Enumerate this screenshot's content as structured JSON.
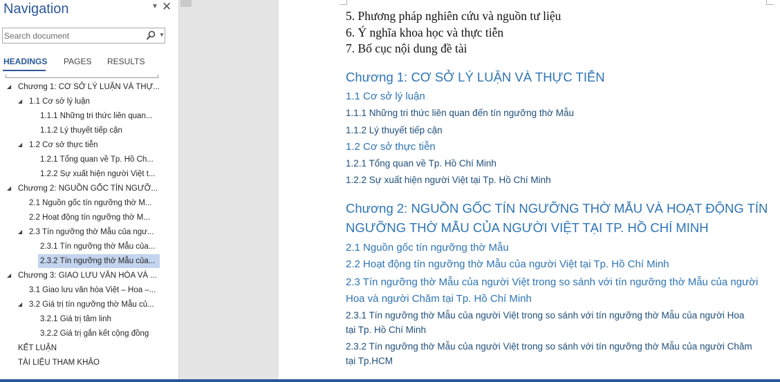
{
  "navigation": {
    "title": "Navigation",
    "search": {
      "placeholder": "Search document"
    },
    "tabs": [
      {
        "label": "HEADINGS",
        "active": true
      },
      {
        "label": "PAGES",
        "active": false
      },
      {
        "label": "RESULTS",
        "active": false
      }
    ],
    "items": [
      {
        "label": "Chương 1: CƠ SỞ LÝ LUẬN VÀ THỰ...",
        "level": 1,
        "expand": "expanded",
        "selected": false
      },
      {
        "label": "1.1 Cơ sở lý luận",
        "level": 2,
        "expand": "expanded",
        "selected": false
      },
      {
        "label": "1.1.1 Những tri thức liên quan...",
        "level": 3,
        "expand": "none",
        "selected": false
      },
      {
        "label": "1.1.2 Lý thuyết tiếp cận",
        "level": 3,
        "expand": "none",
        "selected": false
      },
      {
        "label": "1.2 Cơ sở thực tiễn",
        "level": 2,
        "expand": "expanded",
        "selected": false
      },
      {
        "label": "1.2.1 Tổng quan về Tp. Hồ Ch...",
        "level": 3,
        "expand": "none",
        "selected": false
      },
      {
        "label": "1.2.2 Sự xuất hiện người Việt t...",
        "level": 3,
        "expand": "none",
        "selected": false
      },
      {
        "label": "Chương 2: NGUỒN GỐC TÍN NGƯỠ...",
        "level": 1,
        "expand": "expanded",
        "selected": false
      },
      {
        "label": "2.1 Nguồn gốc tín ngưỡng thờ M...",
        "level": 2,
        "expand": "none",
        "selected": false
      },
      {
        "label": "2.2 Hoạt động tín ngưỡng thờ M...",
        "level": 2,
        "expand": "none",
        "selected": false
      },
      {
        "label": "2.3 Tín ngưỡng thờ Mẫu của ngư...",
        "level": 2,
        "expand": "expanded",
        "selected": false
      },
      {
        "label": "2.3.1 Tín ngưỡng thờ Mẫu của...",
        "level": 3,
        "expand": "none",
        "selected": false
      },
      {
        "label": "2.3.2 Tín ngưỡng thờ Mẫu của...",
        "level": 3,
        "expand": "none",
        "selected": true
      },
      {
        "label": "Chương 3: GIAO LƯU VĂN HÓA VÀ ...",
        "level": 1,
        "expand": "expanded",
        "selected": false
      },
      {
        "label": "3.1 Giao lưu văn hóa Việt – Hoa –...",
        "level": 2,
        "expand": "none",
        "selected": false
      },
      {
        "label": "3.2 Giá trị tín ngưỡng thờ Mẫu củ...",
        "level": 2,
        "expand": "expanded",
        "selected": false
      },
      {
        "label": "3.2.1 Giá trị tâm linh",
        "level": 3,
        "expand": "none",
        "selected": false
      },
      {
        "label": "3.2.2 Giá trị gắn kết cộng đồng",
        "level": 3,
        "expand": "none",
        "selected": false
      },
      {
        "label": "KẾT LUẬN",
        "level": 1,
        "expand": "none",
        "selected": false
      },
      {
        "label": "TÀI LIỆU THAM KHẢO",
        "level": 1,
        "expand": "none",
        "selected": false
      }
    ]
  },
  "document": {
    "lines": [
      {
        "style": "body",
        "text": "5. Phương pháp nghiên cứu và nguồn tư liệu"
      },
      {
        "style": "body",
        "text": "6. Ý nghĩa khoa học và thực tiễn"
      },
      {
        "style": "body",
        "text": "7. Bố cục nội dung đề tài"
      },
      {
        "style": "h1",
        "text": "Chương 1: CƠ SỞ LÝ LUẬN VÀ THỰC TIỄN"
      },
      {
        "style": "h2",
        "text": "1.1 Cơ sở lý luận"
      },
      {
        "style": "h3",
        "text": "1.1.1 Những tri thức liên quan đến tín ngưỡng thờ Mẫu"
      },
      {
        "style": "h3",
        "text": "1.1.2 Lý thuyết tiếp cận"
      },
      {
        "style": "h2",
        "text": "1.2 Cơ sở thực tiễn"
      },
      {
        "style": "h3",
        "text": "1.2.1 Tổng quan về Tp. Hồ Chí Minh"
      },
      {
        "style": "h3",
        "text": "1.2.2 Sự xuất hiện người Việt tại Tp. Hồ Chí Minh"
      },
      {
        "style": "h1",
        "text": "Chương 2: NGUỒN GỐC TÍN NGƯỠNG THỜ MẪU VÀ HOẠT ĐỘNG TÍN"
      },
      {
        "style": "h1",
        "text": "NGƯỠNG THỜ MẪU CỦA NGƯỜI VIỆT TẠI TP. HỒ CHÍ MINH"
      },
      {
        "style": "h2",
        "text": "2.1 Nguồn gốc tín ngưỡng thờ Mẫu"
      },
      {
        "style": "h2",
        "text": "2.2 Hoạt động tín ngưỡng thờ Mẫu của người Việt tại Tp. Hồ Chí Minh"
      },
      {
        "style": "h2",
        "text": "2.3 Tín ngưỡng thờ Mẫu của người Việt trong so sánh với tín ngưỡng thờ Mẫu của người"
      },
      {
        "style": "h2",
        "text": "Hoa và người Chăm tại Tp. Hồ Chí Minh"
      },
      {
        "style": "h3",
        "text": "2.3.1 Tín ngưỡng thờ Mẫu của người Việt trong so sánh với tín ngưỡng thờ Mẫu của người Hoa"
      },
      {
        "style": "h3",
        "text": "tại Tp. Hồ Chí Minh"
      },
      {
        "style": "h3",
        "text": "2.3.2 Tín ngưỡng thờ Mẫu của người Việt trong so sánh với tín ngưỡng thờ Mẫu của người Chăm"
      },
      {
        "style": "h3",
        "text": "tại Tp.HCM"
      }
    ]
  },
  "colors": {
    "accent": "#2b579a",
    "heading": "#2e74b5",
    "selection": "#c3d4ee",
    "gutter": "#e5e5e5"
  }
}
